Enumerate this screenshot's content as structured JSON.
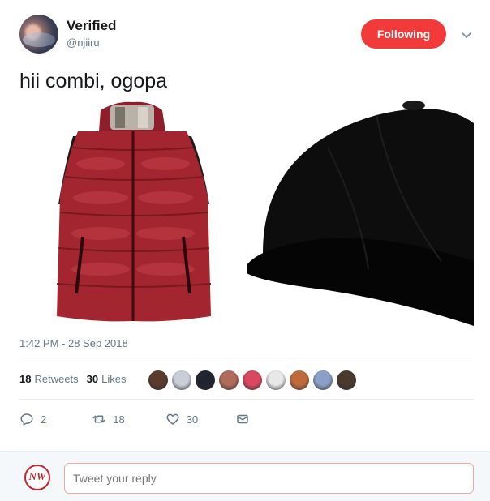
{
  "author": {
    "name": "Verified",
    "handle": "@njiiru"
  },
  "follow_button": {
    "label": "Following",
    "color": "#f23a3a"
  },
  "tweet": {
    "text": "hii combi, ogopa",
    "timestamp": "1:42 PM - 28 Sep 2018"
  },
  "media": [
    {
      "description_icon": "red-puffer-vest-image"
    },
    {
      "description_icon": "black-baseball-cap-image"
    }
  ],
  "stats": {
    "retweets_count": "18",
    "retweets_label": "Retweets",
    "likes_count": "30",
    "likes_label": "Likes"
  },
  "likers": [
    {
      "color": "#5a3b2e"
    },
    {
      "color": "#c9ced8"
    },
    {
      "color": "#1f2430"
    },
    {
      "color": "#b06b5a"
    },
    {
      "color": "#d9485f"
    },
    {
      "color": "#e8e8e8"
    },
    {
      "color": "#c06a3a"
    },
    {
      "color": "#8aa0c8"
    },
    {
      "color": "#4a3a2e"
    }
  ],
  "actions": {
    "replies": "2",
    "retweets": "18",
    "likes": "30"
  },
  "reply": {
    "placeholder": "Tweet your reply",
    "avatar_text": "NW"
  }
}
